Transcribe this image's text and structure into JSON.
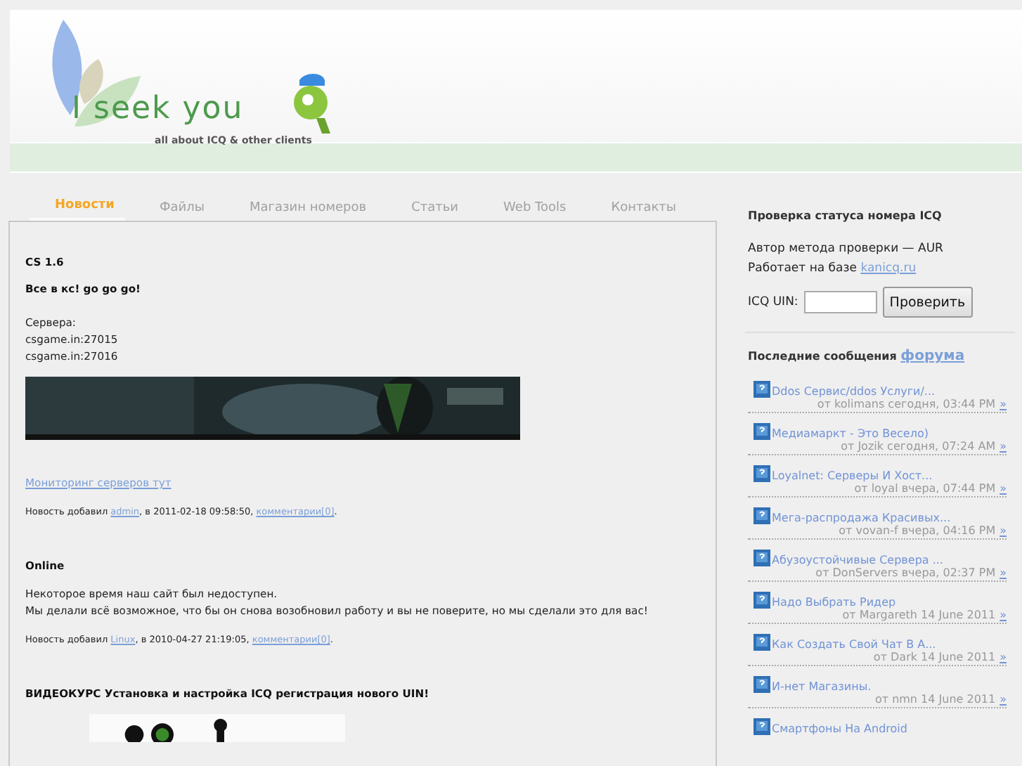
{
  "header": {
    "logo": "I seek you",
    "tagline": "all about ICQ & other clients"
  },
  "tabs": [
    {
      "label": "Новости",
      "selected": true
    },
    {
      "label": "Файлы",
      "selected": false
    },
    {
      "label": "Магазин номеров",
      "selected": false
    },
    {
      "label": "Статьи",
      "selected": false
    },
    {
      "label": "Web Tools",
      "selected": false
    },
    {
      "label": "Контакты",
      "selected": false
    }
  ],
  "news": [
    {
      "title": "CS 1.6",
      "lead": "Все в кс! go go go!",
      "body": [
        "Сервера:",
        "csgame.in:27015",
        "csgame.in:27016"
      ],
      "link": "Мониторинг серверов тут",
      "meta": {
        "prefix": "Новость добавил ",
        "author": "admin",
        "middle": ", в 2011-02-18 09:58:50, ",
        "comments": "комментарии[0]",
        "end": "."
      }
    },
    {
      "title": "Online",
      "body": [
        "Некоторое время наш сайт был недоступен.",
        "Мы делали всё возможное, что бы он снова возобновил работу и вы не поверите, но мы сделали это для вас!"
      ],
      "meta": {
        "prefix": "Новость добавил ",
        "author": "Linux",
        "middle": ", в 2010-04-27 21:19:05, ",
        "comments": "комментарии[0]",
        "end": "."
      }
    },
    {
      "title": "ВИДЕОКУРС Установка и настройка ICQ регистрация нового UIN!"
    }
  ],
  "status_check": {
    "title": "Проверка статуса номера ICQ",
    "author": "Автор метода проверки — AUR",
    "base_text": "Работает на базе ",
    "base_link": "kanicq.ru",
    "field_label": "ICQ UIN:",
    "button": "Проверить"
  },
  "forum": {
    "title": "Последние сообщения ",
    "link": "форума",
    "posts": [
      {
        "title": "Ddos Сервис/ddos Услуги/...",
        "meta": "от kolimans сегодня, 03:44 PM",
        "more": "»"
      },
      {
        "title": "Медиамаркт - Это Весело)",
        "meta": "от Jozik сегодня, 07:24 AM",
        "more": "»"
      },
      {
        "title": "Loyalnet: Серверы И Хост...",
        "meta": "от loyal вчера, 07:44 PM",
        "more": "»"
      },
      {
        "title": "Мега-распродажа Красивых...",
        "meta": "от vovan-f вчера, 04:16 PM",
        "more": "»"
      },
      {
        "title": "Абузоустойчивые Сервера ...",
        "meta": "от DonServers вчера, 02:37 PM",
        "more": "»"
      },
      {
        "title": "Надо Выбрать Ридер",
        "meta": "от Margareth 14 June 2011",
        "more": "»"
      },
      {
        "title": "Как Создать Свой Чат В А...",
        "meta": "от Dark 14 June 2011",
        "more": "»"
      },
      {
        "title": "И-нет Магазины.",
        "meta": "от nmn 14 June 2011",
        "more": "»"
      },
      {
        "title": "Смартфоны На Android"
      }
    ]
  }
}
